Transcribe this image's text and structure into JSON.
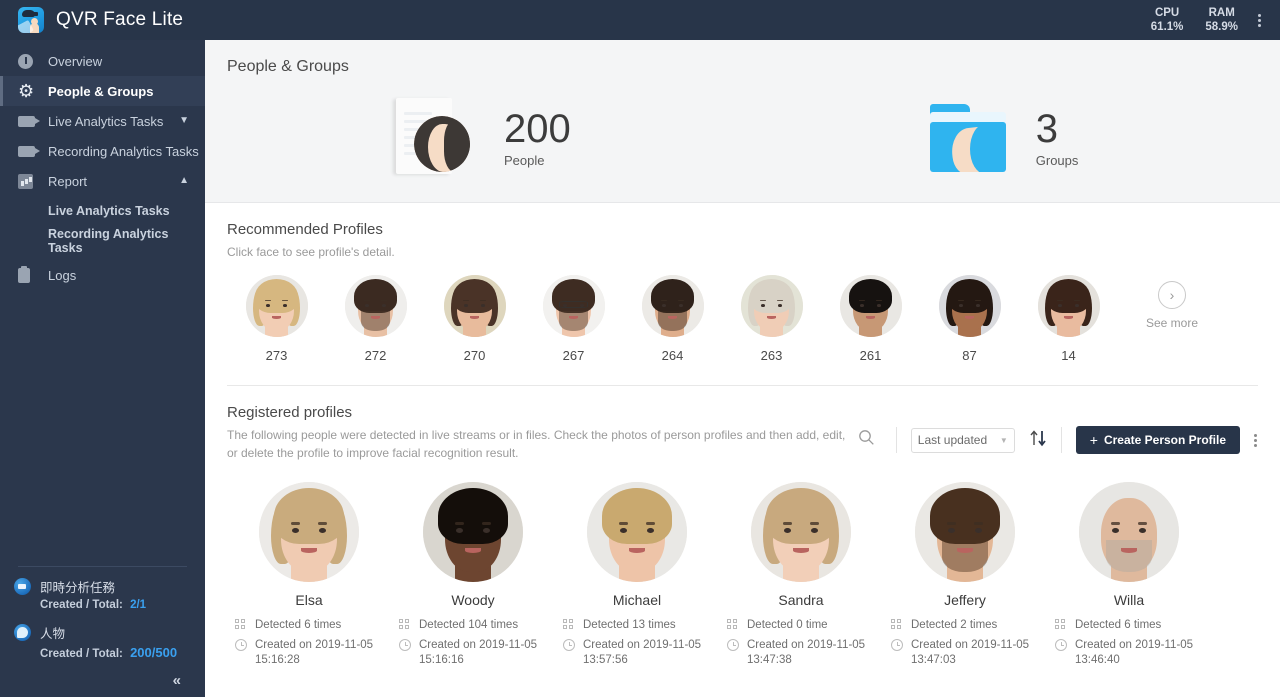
{
  "app": {
    "title": "QVR Face Lite",
    "logo_icon": "qvr-face-logo-icon"
  },
  "topbar": {
    "cpu_label": "CPU",
    "cpu_value": "61.1%",
    "ram_label": "RAM",
    "ram_value": "58.9%",
    "menu_icon": "kebab-menu-icon"
  },
  "sidebar": {
    "items": [
      {
        "label": "Overview",
        "icon": "overview-icon",
        "active": false,
        "chevron": ""
      },
      {
        "label": "People & Groups",
        "icon": "gear-icon",
        "active": true,
        "chevron": ""
      },
      {
        "label": "Live Analytics Tasks",
        "icon": "video-camera-icon",
        "active": false,
        "chevron": "chevron-down-icon"
      },
      {
        "label": "Recording Analytics Tasks",
        "icon": "video-camera-icon",
        "active": false,
        "chevron": ""
      },
      {
        "label": "Report",
        "icon": "bar-chart-icon",
        "active": false,
        "chevron": "chevron-up-icon"
      }
    ],
    "sub_items": [
      {
        "label": "Live Analytics Tasks"
      },
      {
        "label": "Recording Analytics Tasks"
      }
    ],
    "logs": {
      "label": "Logs",
      "icon": "clipboard-icon"
    },
    "quotas": [
      {
        "title": "即時分析任務",
        "icon": "live-task-icon",
        "key": "Created / Total:",
        "value": "2/1"
      },
      {
        "title": "人物",
        "icon": "person-icon",
        "key": "Created / Total:",
        "value": "200/500"
      }
    ],
    "collapse_icon": "collapse-sidebar-icon",
    "collapse_glyph": "«"
  },
  "main": {
    "page_title": "People & Groups",
    "summary": {
      "people": {
        "count": "200",
        "label": "People",
        "icon": "people-illustration-icon"
      },
      "groups": {
        "count": "3",
        "label": "Groups",
        "icon": "groups-folder-icon"
      }
    },
    "recommended": {
      "title": "Recommended Profiles",
      "subtitle": "Click face to see profile's detail.",
      "profiles": [
        {
          "label": "273",
          "avatar": "face-273"
        },
        {
          "label": "272",
          "avatar": "face-272"
        },
        {
          "label": "270",
          "avatar": "face-270"
        },
        {
          "label": "267",
          "avatar": "face-267"
        },
        {
          "label": "264",
          "avatar": "face-264"
        },
        {
          "label": "263",
          "avatar": "face-263"
        },
        {
          "label": "261",
          "avatar": "face-261"
        },
        {
          "label": "87",
          "avatar": "face-87"
        },
        {
          "label": "14",
          "avatar": "face-14"
        }
      ],
      "see_more": {
        "label": "See more",
        "icon": "chevron-right-circle-icon",
        "glyph": "›"
      }
    },
    "registered": {
      "title": "Registered profiles",
      "description": "The following people were detected in live streams or in files. Check the photos of person profiles and then add, edit, or delete the profile to improve facial recognition result.",
      "toolbar": {
        "search_icon": "search-icon",
        "sort_select_value": "Last updated",
        "sort_direction_icon": "sort-updown-icon",
        "create_button": "Create Person Profile",
        "create_plus": "+",
        "more_icon": "kebab-menu-icon"
      },
      "cards": [
        {
          "name": "Elsa",
          "detected": "Detected 6 times",
          "created": "Created on 2019-11-05 15:16:28",
          "avatar": "face-elsa"
        },
        {
          "name": "Woody",
          "detected": "Detected 104 times",
          "created": "Created on 2019-11-05 15:16:16",
          "avatar": "face-woody"
        },
        {
          "name": "Michael",
          "detected": "Detected 13 times",
          "created": "Created on 2019-11-05 13:57:56",
          "avatar": "face-michael"
        },
        {
          "name": "Sandra",
          "detected": "Detected 0 time",
          "created": "Created on 2019-11-05 13:47:38",
          "avatar": "face-sandra"
        },
        {
          "name": "Jeffery",
          "detected": "Detected 2 times",
          "created": "Created on 2019-11-05 13:47:03",
          "avatar": "face-jeffery"
        },
        {
          "name": "Willa",
          "detected": "Detected 6 times",
          "created": "Created on 2019-11-05 13:46:40",
          "avatar": "face-willa"
        }
      ]
    }
  },
  "colors": {
    "sidebar_bg": "#2b374c",
    "topbar_bg": "#283549",
    "accent_blue": "#3aa0ef",
    "button_dark": "#283549",
    "summary_bg": "#f4f5f6"
  }
}
